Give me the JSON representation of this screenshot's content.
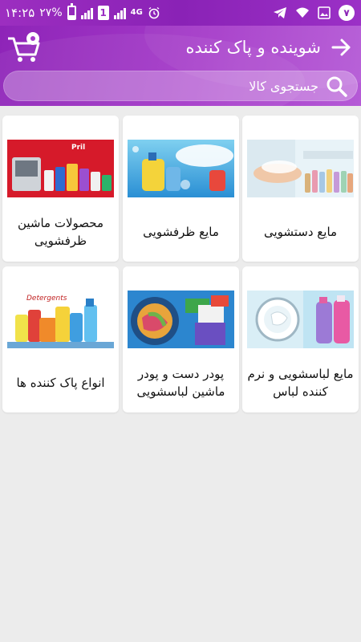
{
  "status_bar": {
    "time": "۱۴:۲۵",
    "battery": "۲۷%",
    "battery_level": 0.27,
    "network": "4G",
    "sim_label": "1",
    "notification_count": "۷"
  },
  "header": {
    "title": "شوینده و پاک کننده",
    "back_icon": "arrow-right-icon",
    "cart_icon": "cart-icon"
  },
  "search": {
    "placeholder": "جستجوی کالا"
  },
  "categories": [
    {
      "label": "مایع دستشویی",
      "image": "hand-soap-image"
    },
    {
      "label": "مایع ظرفشویی",
      "image": "dish-liquid-image"
    },
    {
      "label": "محصولات ماشین ظرفشویی",
      "image": "dishwasher-products-image",
      "image_text": "Pril"
    },
    {
      "label": "مایع لباسشویی و نرم کننده لباس",
      "image": "laundry-liquid-image"
    },
    {
      "label": "پودر دست و پودر ماشین لباسشویی",
      "image": "washing-powder-image"
    },
    {
      "label": "انواع پاک کننده ها",
      "image": "detergents-image",
      "image_text": "Detergents"
    }
  ],
  "colors": {
    "accent": "#8e24b8",
    "background": "#ececec"
  }
}
